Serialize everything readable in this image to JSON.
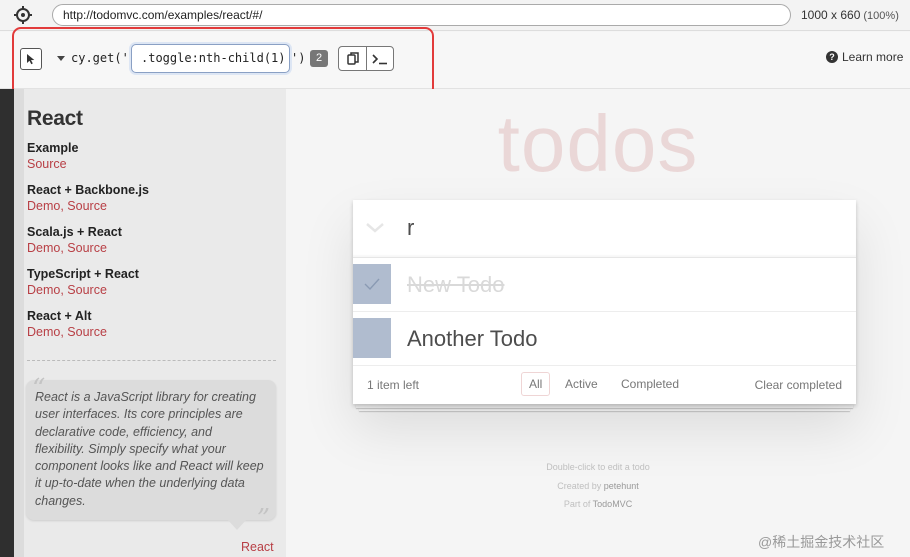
{
  "browser": {
    "url": "http://todomvc.com/examples/react/#/",
    "viewport": "1000 x 660",
    "zoom": "(100%)"
  },
  "selector_playground": {
    "command_prefix": "cy.get('",
    "selector": ".toggle:nth-child(1)",
    "command_suffix": "')",
    "match_count": "2",
    "learn_more": "Learn more",
    "highlight_color": "#e23b3b"
  },
  "sidebar": {
    "title": "React",
    "groups": [
      {
        "name": "Example",
        "links": "Source"
      },
      {
        "name": "React + Backbone.js",
        "links": "Demo, Source"
      },
      {
        "name": "Scala.js + React",
        "links": "Demo, Source"
      },
      {
        "name": "TypeScript + React",
        "links": "Demo, Source"
      },
      {
        "name": "React + Alt",
        "links": "Demo, Source"
      }
    ],
    "quote": "React is a JavaScript library for creating user interfaces. Its core principles are declarative code, efficiency, and flexibility. Simply specify what your component looks like and React will keep it up-to-date when the underlying data changes.",
    "quote_footer": "React"
  },
  "app": {
    "title": "todos",
    "new_todo_value": "r",
    "todos": [
      {
        "label": "New Todo",
        "completed": true
      },
      {
        "label": "Another Todo",
        "completed": false
      }
    ],
    "items_left": "1 item left",
    "filters": [
      "All",
      "Active",
      "Completed"
    ],
    "selected_filter": "All",
    "clear_completed": "Clear completed",
    "accent_color": "#b83f45"
  },
  "info": {
    "line1": "Double-click to edit a todo",
    "line2_prefix": "Created by ",
    "line2_name": "petehunt",
    "line3_prefix": "Part of ",
    "line3_name": "TodoMVC"
  },
  "watermark": "@稀土掘金技术社区"
}
